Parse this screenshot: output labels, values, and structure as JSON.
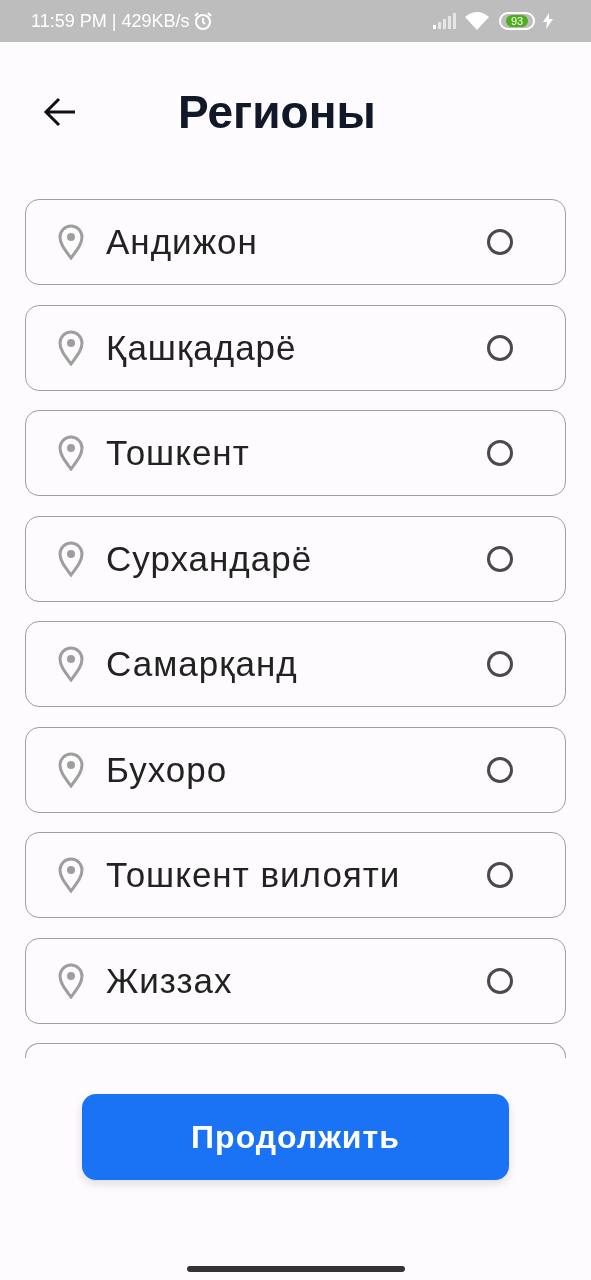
{
  "status_bar": {
    "time": "11:59 PM | 429KB/s",
    "battery": "93"
  },
  "header": {
    "title": "Регионы"
  },
  "regions": [
    {
      "kind": "region",
      "name": "Андижон",
      "selected": false
    },
    {
      "kind": "region",
      "name": "Қашқадарё",
      "selected": false
    },
    {
      "kind": "region",
      "name": "Тошкент",
      "selected": false
    },
    {
      "kind": "region",
      "name": "Сурхандарё",
      "selected": false
    },
    {
      "kind": "region",
      "name": "Самарқанд",
      "selected": false
    },
    {
      "kind": "region",
      "name": "Бухоро",
      "selected": false
    },
    {
      "kind": "region",
      "name": "Тошкент вилояти",
      "selected": false
    },
    {
      "kind": "region",
      "name": "Жиззах",
      "selected": false
    },
    {
      "kind": "partial"
    }
  ],
  "continue_button": {
    "label": "Продолжить"
  }
}
